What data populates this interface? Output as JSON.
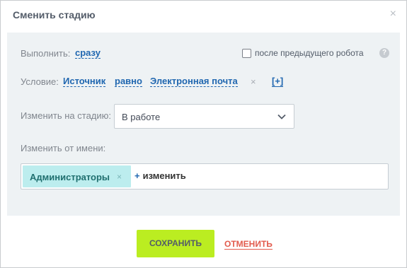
{
  "dialog": {
    "title": "Сменить стадию",
    "close_glyph": "×"
  },
  "run": {
    "label": "Выполнить:",
    "value": "сразу",
    "after_previous_label": "после предыдущего робота",
    "after_previous_checked": false,
    "help_glyph": "?"
  },
  "condition": {
    "label": "Условие:",
    "field": "Источник",
    "operator": "равно",
    "value": "Электронная почта",
    "remove_glyph": "×",
    "add": "[+]"
  },
  "stage": {
    "label": "Изменить на стадию:",
    "selected": "В работе"
  },
  "author": {
    "label": "Изменить от имени:",
    "chip": "Администраторы",
    "chip_remove_glyph": "×",
    "add_plus": "+",
    "add_label": "изменить"
  },
  "footer": {
    "save": "СОХРАНИТЬ",
    "cancel": "ОТМЕНИТЬ"
  },
  "colors": {
    "accent_link": "#2067b0",
    "save_button": "#bbed21",
    "cancel_link": "#e25b4d",
    "chip_bg": "#bcedee",
    "panel_bg": "#eef2f4"
  },
  "icons": {
    "close": "close-icon",
    "help": "help-icon",
    "dropdown": "chevron-down-icon"
  }
}
